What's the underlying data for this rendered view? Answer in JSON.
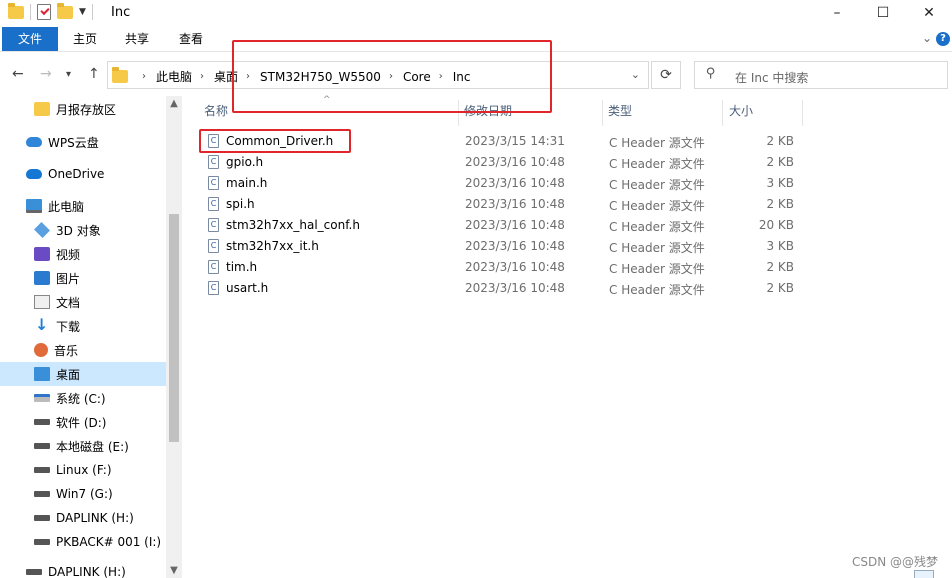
{
  "window": {
    "title": "Inc",
    "minimize": "–",
    "maximize": "☐",
    "close": "✕"
  },
  "ribbon": {
    "tabs": [
      "文件",
      "主页",
      "共享",
      "查看"
    ]
  },
  "nav": {
    "back": "←",
    "forward": "→",
    "recent": "▾",
    "up": "↑",
    "breadcrumbs": [
      "此电脑",
      "桌面",
      "STM32H750_W5500",
      "Core",
      "Inc"
    ],
    "refresh": "⟳",
    "search_placeholder": "在 Inc 中搜索"
  },
  "sidebar": {
    "items": [
      {
        "label": "月报存放区",
        "icon": "folder-icon"
      },
      {
        "label": "WPS云盘",
        "icon": "cloud-icon"
      },
      {
        "label": "OneDrive",
        "icon": "onedrive-icon"
      },
      {
        "label": "此电脑",
        "icon": "computer-icon"
      },
      {
        "label": "3D 对象",
        "icon": "3d-objects-icon"
      },
      {
        "label": "视频",
        "icon": "video-icon"
      },
      {
        "label": "图片",
        "icon": "pictures-icon"
      },
      {
        "label": "文档",
        "icon": "documents-icon"
      },
      {
        "label": "下载",
        "icon": "download-icon"
      },
      {
        "label": "音乐",
        "icon": "music-icon"
      },
      {
        "label": "桌面",
        "icon": "desktop-icon"
      },
      {
        "label": "系统 (C:)",
        "icon": "drive-c-icon"
      },
      {
        "label": "软件 (D:)",
        "icon": "drive-icon"
      },
      {
        "label": "本地磁盘 (E:)",
        "icon": "drive-icon"
      },
      {
        "label": "Linux (F:)",
        "icon": "drive-icon"
      },
      {
        "label": "Win7 (G:)",
        "icon": "drive-icon"
      },
      {
        "label": "DAPLINK (H:)",
        "icon": "drive-icon"
      },
      {
        "label": "PKBACK# 001 (I:)",
        "icon": "drive-icon"
      },
      {
        "label": "DAPLINK (H:)",
        "icon": "drive-icon"
      }
    ],
    "selected": "桌面"
  },
  "columns": {
    "name": "名称",
    "date": "修改日期",
    "type": "类型",
    "size": "大小"
  },
  "files": [
    {
      "name": "Common_Driver.h",
      "date": "2023/3/15 14:31",
      "type": "C Header 源文件",
      "size": "2 KB"
    },
    {
      "name": "gpio.h",
      "date": "2023/3/16 10:48",
      "type": "C Header 源文件",
      "size": "2 KB"
    },
    {
      "name": "main.h",
      "date": "2023/3/16 10:48",
      "type": "C Header 源文件",
      "size": "3 KB"
    },
    {
      "name": "spi.h",
      "date": "2023/3/16 10:48",
      "type": "C Header 源文件",
      "size": "2 KB"
    },
    {
      "name": "stm32h7xx_hal_conf.h",
      "date": "2023/3/16 10:48",
      "type": "C Header 源文件",
      "size": "20 KB"
    },
    {
      "name": "stm32h7xx_it.h",
      "date": "2023/3/16 10:48",
      "type": "C Header 源文件",
      "size": "3 KB"
    },
    {
      "name": "tim.h",
      "date": "2023/3/16 10:48",
      "type": "C Header 源文件",
      "size": "2 KB"
    },
    {
      "name": "usart.h",
      "date": "2023/3/16 10:48",
      "type": "C Header 源文件",
      "size": "2 KB"
    }
  ],
  "file_icon_letter": "C",
  "watermark": "CSDN @@残梦",
  "colors": {
    "accent": "#1a6fc9",
    "selection": "#cce8ff",
    "annotation": "#e0262a"
  }
}
